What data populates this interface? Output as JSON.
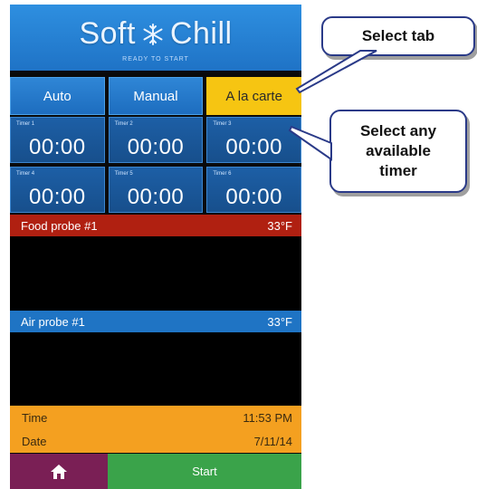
{
  "app": {
    "title": "Soft Chill",
    "status": "READY TO START"
  },
  "tabs": [
    {
      "label": "Auto",
      "active": false
    },
    {
      "label": "Manual",
      "active": false
    },
    {
      "label": "A la carte",
      "active": true
    }
  ],
  "timers": [
    {
      "label": "Timer 1",
      "value": "00:00"
    },
    {
      "label": "Timer 2",
      "value": "00:00"
    },
    {
      "label": "Timer 3",
      "value": "00:00"
    },
    {
      "label": "Timer 4",
      "value": "00:00"
    },
    {
      "label": "Timer 5",
      "value": "00:00"
    },
    {
      "label": "Timer 6",
      "value": "00:00"
    }
  ],
  "probes": [
    {
      "label": "Food probe #1",
      "temp": "33°F"
    },
    {
      "label": "Air probe #1",
      "temp": "33°F"
    }
  ],
  "info": {
    "time_label": "Time",
    "time_value": "11:53 PM",
    "date_label": "Date",
    "date_value": "7/11/14"
  },
  "bottom": {
    "home_icon": "home-icon",
    "start_label": "Start"
  },
  "callouts": {
    "select_tab": "Select tab",
    "select_timer_line1": "Select any",
    "select_timer_line2": "available",
    "select_timer_line3": "timer"
  },
  "colors": {
    "header_blue": "#1f73c6",
    "active_tab": "#f6c512",
    "food_probe": "#b02011",
    "air_probe": "#1f74c4",
    "info_bar": "#f4a020",
    "home_button": "#7a1f55",
    "start_button": "#3aa34a"
  }
}
